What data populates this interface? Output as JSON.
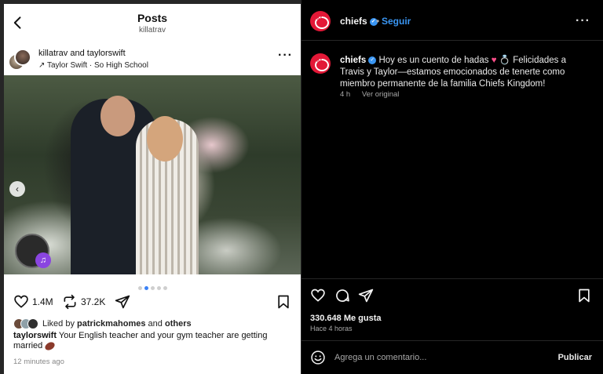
{
  "left_post": {
    "header": {
      "title": "Posts",
      "subtitle": "killatrav"
    },
    "post_header": {
      "author1": "killatrav",
      "joiner": " and ",
      "author2": "taylorswift",
      "music": "Taylor Swift · So High School",
      "more": "···"
    },
    "carousel": {
      "arrow": "‹",
      "dot_count": 5,
      "active_dot": 2
    },
    "actions": {
      "likes": "1.4M",
      "reposts": "37.2K"
    },
    "liked_by": {
      "prefix": "Liked by",
      "user": "patrickmahomes",
      "joiner": "and",
      "others": "others"
    },
    "caption": {
      "user": "taylorswift",
      "text": "Your English teacher and your gym teacher are getting married"
    },
    "time": "12 minutes ago"
  },
  "right_post": {
    "header": {
      "account": "chiefs",
      "dot": "•",
      "follow": "Seguir",
      "more": "···"
    },
    "comment": {
      "account": "chiefs",
      "text_part1": "Hoy es un cuento de hadas",
      "emoji1": "♥",
      "emoji2": "💍",
      "text_part2": "Felicidades a Travis y Taylor—estamos emocionados de tenerte como miembro permanente de la familia Chiefs Kingdom!",
      "time": "4 h",
      "view_original": "Ver original"
    },
    "likes": "330.648 Me gusta",
    "time": "Hace 4 horas",
    "input": {
      "placeholder": "Agrega un comentario...",
      "post_button": "Publicar"
    }
  },
  "colors": {
    "accent_blue": "#3a96f3",
    "chiefs_red": "#e31837",
    "dark_bg": "#000000",
    "light_bg": "#ffffff"
  },
  "icons": [
    "back-arrow-icon",
    "more-icon",
    "music-arrow-icon",
    "carousel-prev-icon",
    "heart-icon",
    "repost-icon",
    "share-icon",
    "bookmark-icon",
    "comment-icon",
    "emoji-icon",
    "verified-icon"
  ]
}
